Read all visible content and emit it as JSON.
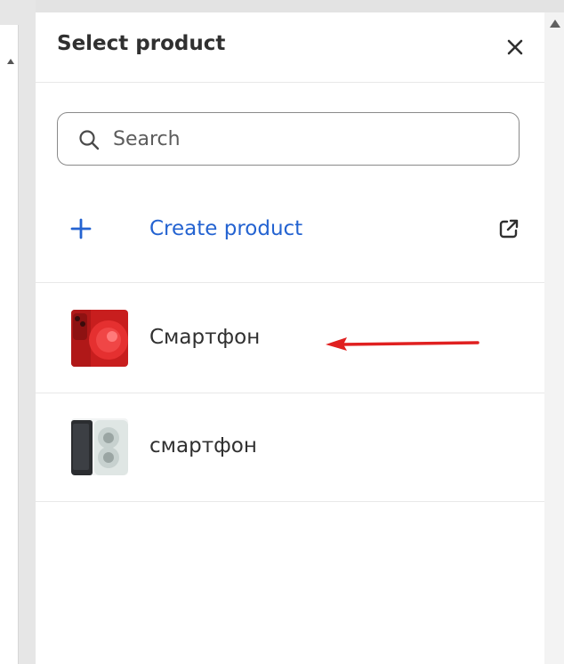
{
  "panel": {
    "title": "Select product",
    "close_icon": "close-icon"
  },
  "search": {
    "placeholder": "Search",
    "value": "",
    "icon": "search-icon"
  },
  "create": {
    "label": "Create product",
    "plus_icon": "plus-icon",
    "external_icon": "external-link-icon"
  },
  "products": [
    {
      "name": "Смартфон",
      "thumbnail": "red-phone-thumbnail"
    },
    {
      "name": "смартфон",
      "thumbnail": "white-phone-thumbnail"
    }
  ],
  "annotation": {
    "type": "arrow",
    "color": "#e02020",
    "points_to": "product-0"
  },
  "colors": {
    "link": "#2463d1",
    "text": "#303030",
    "border": "#8a8a8a",
    "divider": "#e8e8e8"
  }
}
